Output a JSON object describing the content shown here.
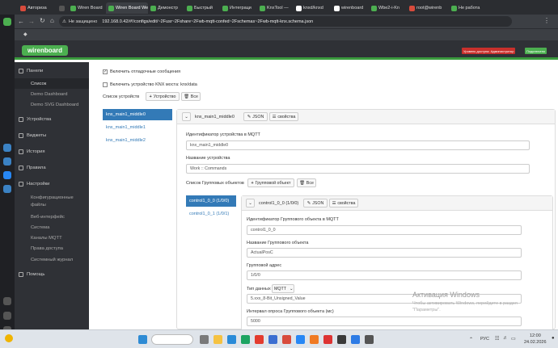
{
  "browser": {
    "tabs": [
      {
        "label": "Авториза",
        "color": "#d84b3c",
        "active": false
      },
      {
        "label": "",
        "color": "#555",
        "active": false
      },
      {
        "label": "Wiren Board",
        "color": "#4caf50",
        "active": false
      },
      {
        "label": "Wiren Board Web",
        "color": "#4caf50",
        "active": true
      },
      {
        "label": "Демонстр",
        "color": "#4caf50",
        "active": false
      },
      {
        "label": "Быстрый",
        "color": "#4caf50",
        "active": false
      },
      {
        "label": "Интеграци",
        "color": "#4caf50",
        "active": false
      },
      {
        "label": "KnxTool —",
        "color": "#4caf50",
        "active": false
      },
      {
        "label": "knxd/knxd",
        "color": "#ffffff",
        "active": false
      },
      {
        "label": "wirenboard",
        "color": "#ffffff",
        "active": false
      },
      {
        "label": "Wbe2-i-Kn",
        "color": "#4caf50",
        "active": false
      },
      {
        "label": "root@wirenb",
        "color": "#d84b3c",
        "active": false
      },
      {
        "label": "Не работа",
        "color": "#4caf50",
        "active": false
      }
    ],
    "security_label": "Не защищено",
    "url": "192.168.0.42/#!/configs/edit/~2Fusr~2Fshare~2Fwb-mqtt-confed~2Fschemas~2Fwb-mqtt-knx.schema.json"
  },
  "header": {
    "logo": "wirenboard",
    "access_badge": "Уровень доступа: Администратор",
    "connected_badge": "Подключено",
    "access_color": "#c9302c",
    "connected_color": "#4caf50"
  },
  "sidebar": {
    "items": [
      {
        "label": "Панели",
        "sub": false,
        "active": false
      },
      {
        "label": "Список",
        "sub": true,
        "active": true
      },
      {
        "label": "Demo Dashboard",
        "sub": true,
        "active": false
      },
      {
        "label": "Demo SVG Dashboard",
        "sub": true,
        "active": false
      },
      {
        "label": "Устройства",
        "sub": false,
        "active": false
      },
      {
        "label": "Виджеты",
        "sub": false,
        "active": false
      },
      {
        "label": "История",
        "sub": false,
        "active": false
      },
      {
        "label": "Правила",
        "sub": false,
        "active": false
      },
      {
        "label": "Настройки",
        "sub": false,
        "active": false
      },
      {
        "label": "Конфигурационные",
        "sub": true,
        "active": false
      },
      {
        "label": "файлы",
        "sub": true,
        "active": false
      },
      {
        "label": "Веб-интерфейс",
        "sub": true,
        "active": false
      },
      {
        "label": "Система",
        "sub": true,
        "active": false
      },
      {
        "label": "Каналы MQTT",
        "sub": true,
        "active": false
      },
      {
        "label": "Права доступа",
        "sub": true,
        "active": false
      },
      {
        "label": "Системный журнал",
        "sub": true,
        "active": false
      },
      {
        "label": "Помощь",
        "sub": false,
        "active": false
      }
    ]
  },
  "main": {
    "debug_checkbox_label": "Включить отладочные сообщения",
    "knx_checkbox_label": "Включить устройство KNX моста: knx/data",
    "device_list_label": "Список устройств",
    "add_device_label": "Устройство",
    "all_label": "Все",
    "devices": [
      {
        "label": "knx_main1_middle0",
        "active": true
      },
      {
        "label": "knx_main1_middle1",
        "active": false
      },
      {
        "label": "knx_main1_middle2",
        "active": false
      }
    ],
    "device_panel": {
      "title": "knx_main1_middle0",
      "json_label": "JSON",
      "props_label": "свойства",
      "mqtt_id_label": "Идентификатор устройства в MQTT",
      "mqtt_id_value": "knx_main1_middle0",
      "name_label": "Название устройства",
      "name_value": "Work :: Commands",
      "group_list_label": "Список Групповых объектов",
      "add_group_label": "Групповой объект",
      "all_label": "Все"
    },
    "groups": [
      {
        "label": "control1_0_0 (1/0/0)",
        "active": true
      },
      {
        "label": "control1_0_1 (1/0/1)",
        "active": false
      }
    ],
    "group_panel": {
      "title": "control1_0_0 (1/0/0)",
      "json_label": "JSON",
      "props_label": "свойства",
      "mqtt_id_label": "Идентификатор Группового объекта в MQTT",
      "mqtt_id_value": "control1_0_0",
      "name_label": "Название Группового объекта",
      "name_value": "ActualPosC",
      "address_label": "Групповой адрес",
      "address_value": "1/0/0",
      "type_label": "Тип данных",
      "type_select": "MQTT",
      "type_value": "5.xxx_8-Bit_Unsigned_Value",
      "poll_label": "Интервал опроса Группового объекта (мс)",
      "poll_value": "5000"
    }
  },
  "watermark": {
    "title": "Активация Windows",
    "line1": "Чтобы активировать Windows, перейдите в раздел",
    "line2": "\"Параметры\"."
  },
  "taskbar": {
    "lang": "РУС",
    "time": "12:00",
    "date": "24.02.2026"
  }
}
